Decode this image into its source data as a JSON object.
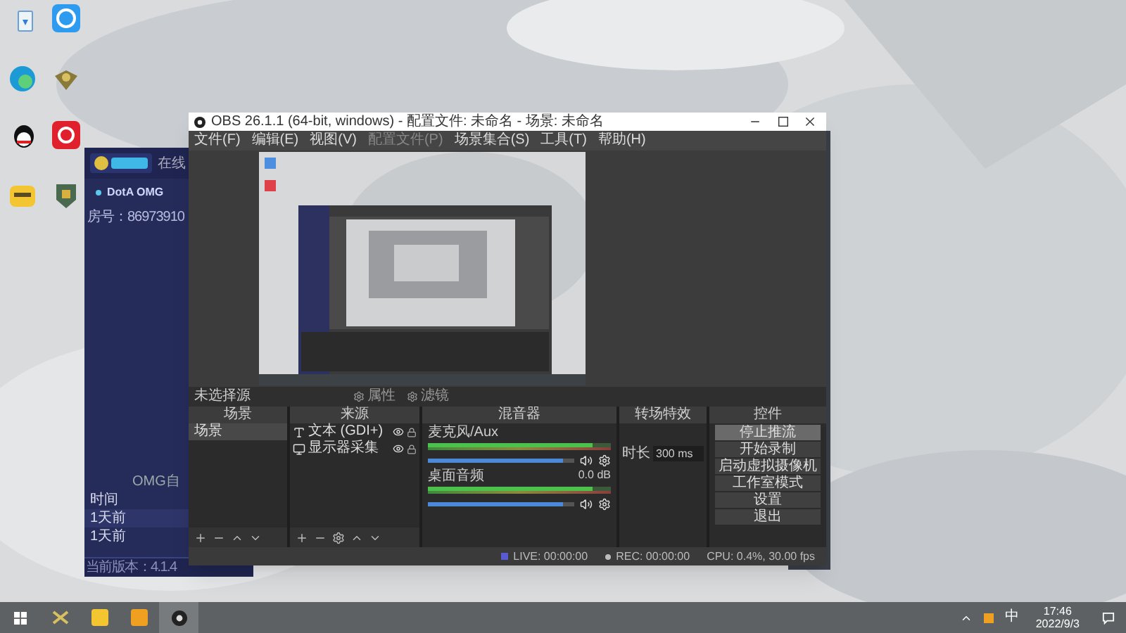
{
  "background_app": {
    "header_link": "在线",
    "tab": "DotA OMG",
    "room": "房号：86973910",
    "list_title": "OMG自",
    "rows": [
      "时间",
      "1天前",
      "1天前"
    ],
    "version": "当前版本：4.1.4"
  },
  "obs": {
    "title": "OBS 26.1.1 (64-bit, windows) - 配置文件: 未命名 - 场景: 未命名",
    "menu": [
      {
        "label": "文件(F)",
        "disabled": false
      },
      {
        "label": "编辑(E)",
        "disabled": false
      },
      {
        "label": "视图(V)",
        "disabled": false
      },
      {
        "label": "配置文件(P)",
        "disabled": true
      },
      {
        "label": "场景集合(S)",
        "disabled": false
      },
      {
        "label": "工具(T)",
        "disabled": false
      },
      {
        "label": "帮助(H)",
        "disabled": false
      }
    ],
    "selection_label": "未选择源",
    "properties_button": "属性",
    "filters_button": "滤镜",
    "scenes": {
      "title": "场景",
      "items": [
        {
          "name": "场景",
          "selected": true
        }
      ]
    },
    "sources": {
      "title": "来源",
      "items": [
        {
          "kind": "text",
          "name": "文本 (GDI+)",
          "visible": true
        },
        {
          "kind": "display",
          "name": "显示器采集",
          "visible": true
        }
      ]
    },
    "mixer": {
      "title": "混音器",
      "channels": [
        {
          "name": "麦克风/Aux",
          "level": 0.92
        },
        {
          "name": "桌面音频",
          "reading": "0.0 dB",
          "level": 0.92
        }
      ]
    },
    "transitions": {
      "title": "转场特效",
      "duration_label": "时长",
      "duration": "300 ms"
    },
    "controls": {
      "title": "控件",
      "buttons": [
        {
          "label": "停止推流",
          "selected": true
        },
        {
          "label": "开始录制",
          "selected": false
        },
        {
          "label": "启动虚拟摄像机",
          "selected": false
        },
        {
          "label": "工作室模式",
          "selected": false
        },
        {
          "label": "设置",
          "selected": false
        },
        {
          "label": "退出",
          "selected": false
        }
      ]
    },
    "status": {
      "live": "LIVE: 00:00:00",
      "rec": "REC: 00:00:00",
      "cpu": "CPU: 0.4%, 30.00 fps"
    }
  },
  "taskbar": {
    "ime": "中",
    "time": "17:46",
    "date": "2022/9/3"
  }
}
